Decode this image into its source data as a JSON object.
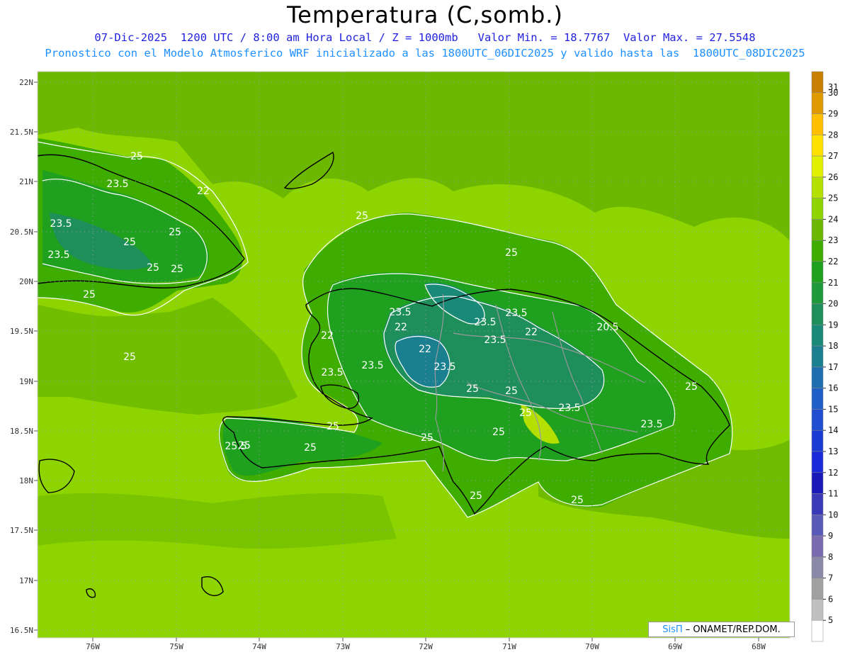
{
  "title": "Temperatura (C,somb.)",
  "subtitle_line1": "07-Dic-2025  1200 UTC / 8:00 am Hora Local / Z = 1000mb   Valor Min. = 18.7767  Valor Max. = 27.5548",
  "subtitle_line2": "Pronostico con el Modelo Atmosferico WRF inicializado a las 1800UTC_06DIC2025 y valido hasta las  1800UTC_08DIC2025",
  "credit_system": "SisΠ",
  "credit_org": "– ONAMET/REP.DOM.",
  "lat_labels": [
    "22N",
    "21.5N",
    "21N",
    "20.5N",
    "20N",
    "19.5N",
    "19N",
    "18.5N",
    "18N",
    "17.5N",
    "17N",
    "16.5N"
  ],
  "lon_labels": [
    "76W",
    "75W",
    "74W",
    "73W",
    "72W",
    "71W",
    "70W",
    "69W",
    "68W"
  ],
  "colorbar": {
    "levels": [
      "31",
      "30",
      "29",
      "28",
      "27",
      "26",
      "25",
      "24",
      "23",
      "22",
      "21",
      "20",
      "19",
      "18",
      "17",
      "16",
      "15",
      "14",
      "13",
      "12",
      "11",
      "10",
      "9",
      "8",
      "7",
      "6",
      "5"
    ],
    "colors": [
      "#c98000",
      "#e09a00",
      "#ffbf00",
      "#ffe100",
      "#e0f000",
      "#b4e000",
      "#8ed400",
      "#6cb800",
      "#3fad00",
      "#1fa01f",
      "#1e9a3c",
      "#1e8f5a",
      "#1a8a78",
      "#1a8090",
      "#1f6fb0",
      "#1f5fc8",
      "#1f4fd0",
      "#1a3ad4",
      "#1a2ad8",
      "#1a1ab8",
      "#3a3ab8",
      "#5a5ab8",
      "#7a6ab0",
      "#8a8aa8",
      "#a0a0a0",
      "#c0c0c0",
      "#ffffff"
    ]
  },
  "contour_labels": [
    "25",
    "23.5",
    "22",
    "23.5",
    "25",
    "25",
    "23.5",
    "25",
    "25",
    "25",
    "25",
    "25",
    "22",
    "23.5",
    "23.5",
    "22",
    "23.5",
    "20.5",
    "22",
    "22",
    "23.5",
    "23.5",
    "25",
    "25",
    "23.5",
    "23.5",
    "23.5",
    "25",
    "25",
    "25",
    "25",
    "25",
    "25",
    "25",
    "25.5",
    "25",
    "25",
    "25",
    "23.5"
  ],
  "colors": {
    "ocean": "#8ed400",
    "land_high": "#6cb800",
    "land_mid": "#3fad00",
    "land_cool": "#1fa01f",
    "land_cold": "#1e8f5a",
    "contour": "#ffffff",
    "coast": "#000000",
    "border": "#999999"
  }
}
